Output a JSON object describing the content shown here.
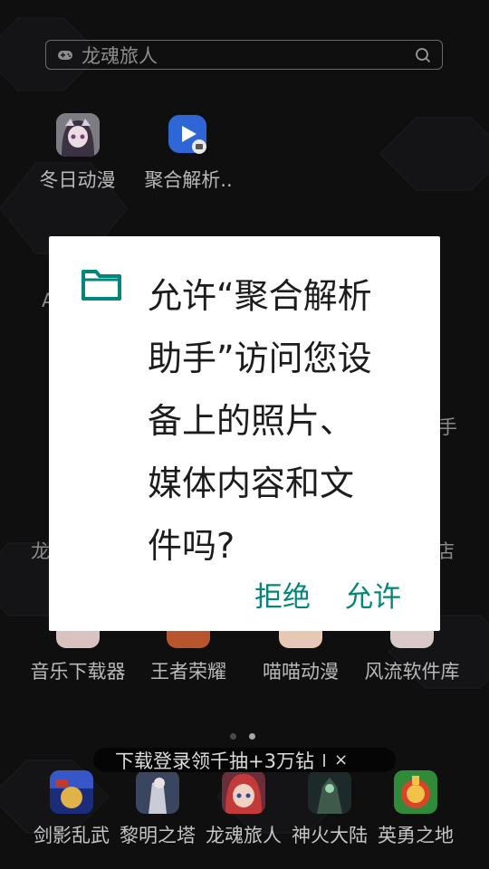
{
  "search": {
    "text": "龙魂旅人"
  },
  "apps_row1": [
    {
      "label": "冬日动漫",
      "icon": "anime-girl-icon"
    },
    {
      "label": "聚合解析..",
      "icon": "video-play-icon"
    }
  ],
  "apps_row3": [
    {
      "label": "音乐下载器"
    },
    {
      "label": "王者荣耀"
    },
    {
      "label": "喵喵动漫"
    },
    {
      "label": "风流软件库"
    }
  ],
  "partial_labels": {
    "left_a": "A",
    "left_long": "龙",
    "right_hand": "手",
    "right_shop": "店"
  },
  "dialog": {
    "message": "允许“聚合解析助手”访问您设备上的照片、媒体内容和文件吗?",
    "lines": [
      "允许“聚合解析",
      "助手”访问您设",
      "备上的照片、",
      "媒体内容和文",
      "件吗?"
    ],
    "deny_label": "拒绝",
    "allow_label": "允许",
    "accent": "#00867a"
  },
  "banner": {
    "text": "下载登录领千抽+3万钻",
    "close": "×"
  },
  "dock": [
    {
      "label": "剑影乱武"
    },
    {
      "label": "黎明之塔"
    },
    {
      "label": "龙魂旅人"
    },
    {
      "label": "神火大陆"
    },
    {
      "label": "英勇之地"
    }
  ],
  "pager": {
    "pages": 2,
    "current": 2
  }
}
